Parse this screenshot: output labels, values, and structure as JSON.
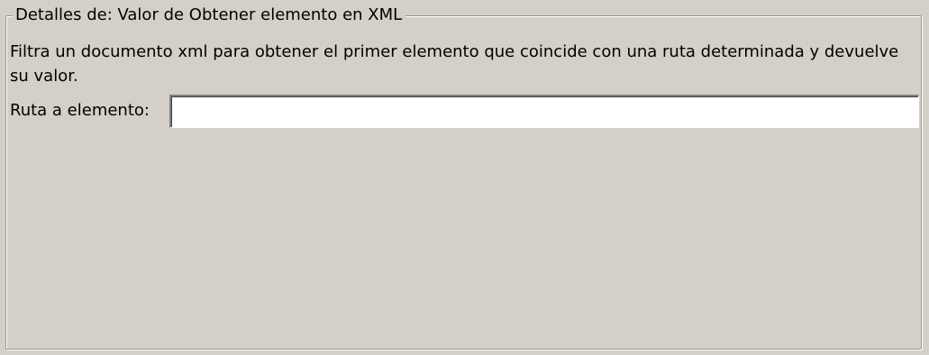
{
  "group": {
    "legend": "Detalles de: Valor de Obtener elemento en XML"
  },
  "description": "Filtra un documento xml para obtener el primer elemento que coincide con una ruta determinada y devuelve su valor.",
  "field": {
    "label": "Ruta a elemento:",
    "value": "",
    "placeholder": ""
  }
}
